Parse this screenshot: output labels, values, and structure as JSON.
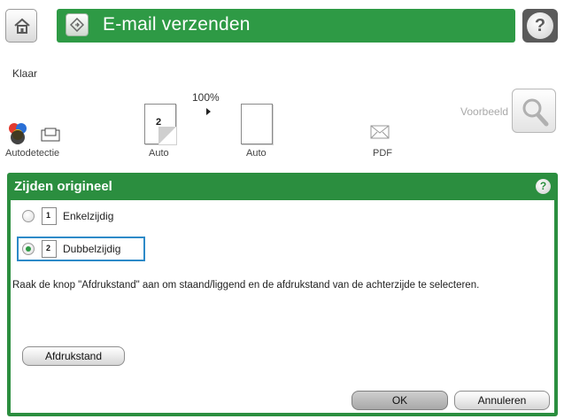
{
  "header": {
    "title": "E-mail verzenden"
  },
  "status": {
    "text": "Klaar",
    "zoom": "100%"
  },
  "settings": {
    "color_label": "Autodetectie",
    "sides_label": "Auto",
    "sides_thumb_number": "2",
    "content_label": "Auto",
    "filetype_label": "PDF",
    "preview_label": "Voorbeeld"
  },
  "dialog": {
    "title": "Zijden origineel",
    "options": [
      {
        "number": "1",
        "label": "Enkelzijdig",
        "selected": false
      },
      {
        "number": "2",
        "label": "Dubbelzijdig",
        "selected": true
      }
    ],
    "hint": "Raak de knop \"Afdrukstand\" aan om staand/liggend en de afdrukstand van de achterzijde te selecteren.",
    "orientation_button": "Afdrukstand",
    "ok_button": "OK",
    "cancel_button": "Annuleren"
  },
  "colors": {
    "accent_green": "#2e9a45",
    "selection_blue": "#2d8ac8"
  }
}
